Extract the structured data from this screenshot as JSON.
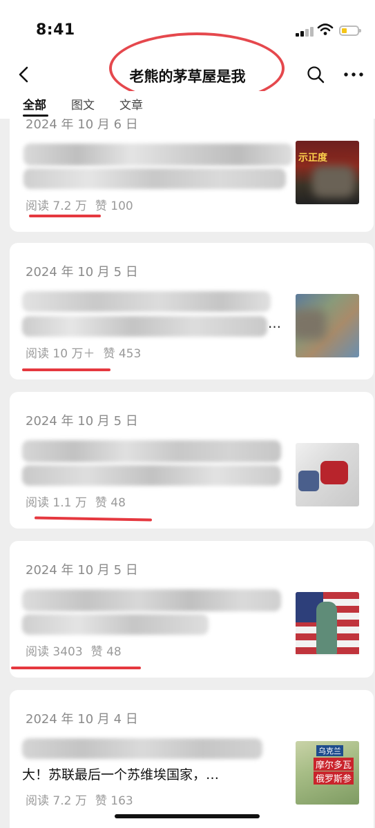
{
  "status_bar": {
    "time": "8:41"
  },
  "nav": {
    "title": "老熊的茅草屋是我"
  },
  "tabs": [
    {
      "label": "全部",
      "active": true
    },
    {
      "label": "图文",
      "active": false
    },
    {
      "label": "文章",
      "active": false
    }
  ],
  "articles": [
    {
      "date": "2024 年 10 月 6 日",
      "reads": "阅读 7.2 万",
      "likes": "赞 100"
    },
    {
      "date": "2024 年 10 月 5 日",
      "title_line2": "…",
      "reads": "阅读 10 万＋",
      "likes": "赞 453"
    },
    {
      "date": "2024 年 10 月 5 日",
      "reads": "阅读 1.1 万",
      "likes": "赞 48"
    },
    {
      "date": "2024 年 10 月 5 日",
      "reads": "阅读 3403",
      "likes": "赞 48"
    },
    {
      "date": "2024 年 10 月 4 日",
      "title_line2": "大！苏联最后一个苏维埃国家，…",
      "reads": "阅读 7.2 万",
      "likes": "赞 163"
    }
  ],
  "thumb_texts": {
    "t1": "示正度",
    "t5_a": "乌克兰",
    "t5_b": "摩尔多瓦",
    "t5_c": "俄罗斯参"
  },
  "colors": {
    "accent_red": "#e5383f",
    "background": "#eeeeee",
    "card": "#ffffff"
  }
}
